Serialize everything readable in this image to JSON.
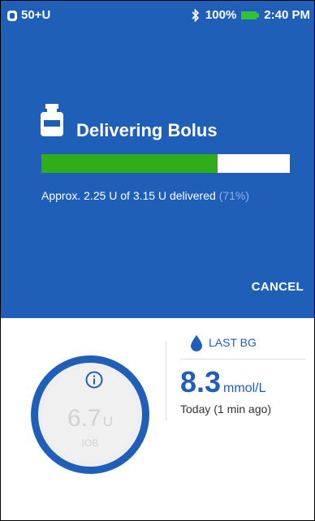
{
  "status_bar": {
    "reservoir_text": "50+U",
    "battery_text": "100%",
    "time": "2:40 PM"
  },
  "bolus": {
    "title": "Delivering Bolus",
    "progress_fraction": 0.71,
    "delivered_text": "Approx. 2.25 U of 3.15 U delivered",
    "percent_text": "(71%)",
    "cancel_label": "CANCEL"
  },
  "iob": {
    "value": "6.7",
    "unit": "U",
    "label": "IOB"
  },
  "last_bg": {
    "label": "LAST BG",
    "value": "8.3",
    "unit": "mmol/L",
    "time": "Today (1 min ago)"
  },
  "colors": {
    "primary_blue": "#1f5fb8",
    "progress_green": "#2fae1a",
    "battery_green": "#35c03a"
  },
  "icons": [
    "reservoir-icon",
    "bluetooth-icon",
    "battery-icon",
    "insulin-vial-icon",
    "info-icon",
    "blood-drop-icon"
  ]
}
